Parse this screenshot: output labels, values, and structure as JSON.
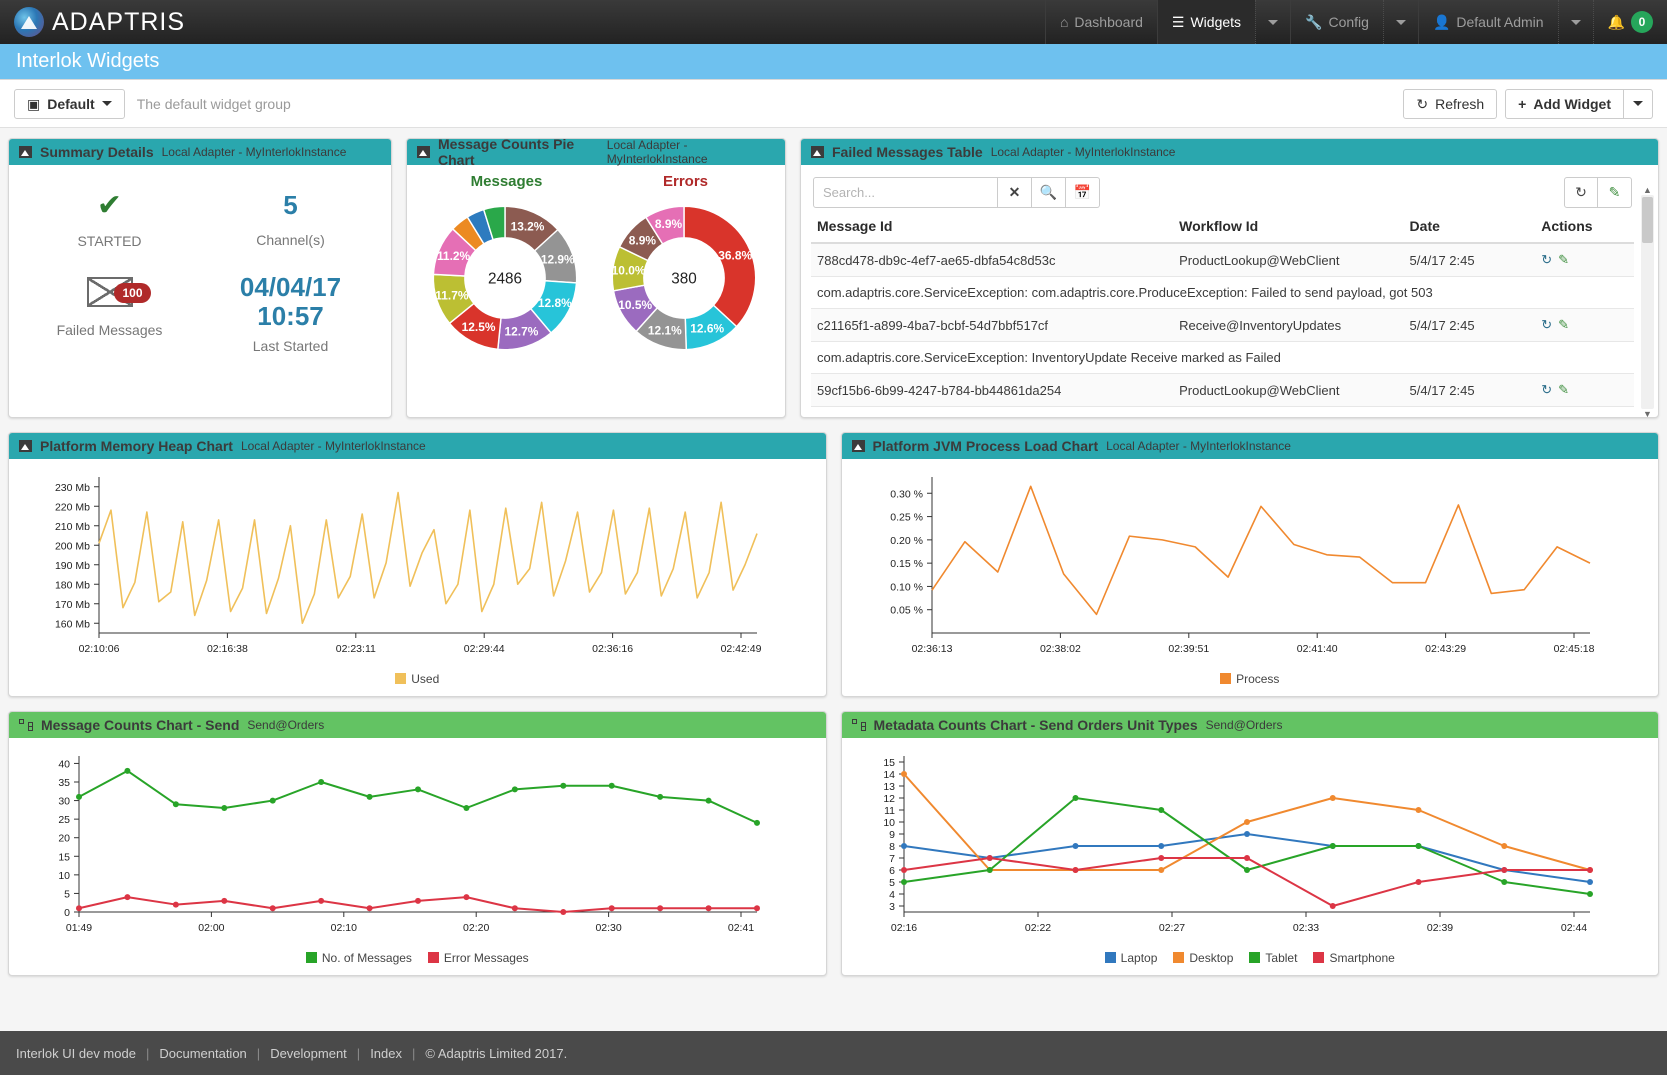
{
  "navbar": {
    "brand": "ADAPTRIS",
    "items": [
      {
        "label": "Dashboard",
        "icon": "home-icon",
        "active": false,
        "caret": false
      },
      {
        "label": "Widgets",
        "icon": "widgets-icon",
        "active": true,
        "caret": true
      },
      {
        "label": "Config",
        "icon": "wrench-icon",
        "active": false,
        "caret": true
      },
      {
        "label": "Default Admin",
        "icon": "user-icon",
        "active": false,
        "caret": true
      }
    ],
    "notification_count": "0",
    "notification_icon": "bell-icon"
  },
  "page": {
    "title": "Interlok Widgets"
  },
  "toolbar": {
    "group_button": "Default",
    "group_icon": "widget-group-icon",
    "description": "The default widget group",
    "refresh_label": "Refresh",
    "refresh_icon": "refresh-icon",
    "add_widget_label": "Add Widget",
    "add_widget_icon": "plus-icon"
  },
  "summary": {
    "title": "Summary Details",
    "subtitle": "Local Adapter - MyInterlokInstance",
    "status_value": "STARTED",
    "status_icon": "check-icon",
    "channels_value": "5",
    "channels_label": "Channel(s)",
    "failed_count": "100",
    "failed_label": "Failed Messages",
    "failed_icon": "envelope-icon",
    "last_started_value": "04/04/17 10:57",
    "last_started_value_line1": "04/04/17",
    "last_started_value_line2": "10:57",
    "last_started_label": "Last Started"
  },
  "pie": {
    "title": "Message Counts Pie Chart",
    "subtitle": "Local Adapter - MyInterlokInstance"
  },
  "table": {
    "title": "Failed Messages Table",
    "subtitle": "Local Adapter - MyInterlokInstance",
    "search_placeholder": "Search...",
    "search_value": "",
    "clear_icon": "x-icon",
    "search_icon": "magnifier-icon",
    "calendar_icon": "calendar-icon",
    "refresh_icon": "refresh-icon",
    "clean_icon": "eraser-icon",
    "columns": [
      "Message Id",
      "Workflow Id",
      "Date",
      "Actions"
    ],
    "rows": [
      {
        "message_id": "788cd478-db9c-4ef7-ae65-dbfa54c8d53c",
        "workflow_id": "ProductLookup@WebClient",
        "date": "5/4/17 2:45",
        "detail": "com.adaptris.core.ServiceException: com.adaptris.core.ProduceException: Failed to send payload, got 503"
      },
      {
        "message_id": "c21165f1-a899-4ba7-bcbf-54d7bbf517cf",
        "workflow_id": "Receive@InventoryUpdates",
        "date": "5/4/17 2:45",
        "detail": "com.adaptris.core.ServiceException: InventoryUpdate Receive marked as Failed"
      },
      {
        "message_id": "59cf15b6-6b99-4247-b784-bb44861da254",
        "workflow_id": "ProductLookup@WebClient",
        "date": "5/4/17 2:45",
        "detail": ""
      }
    ]
  },
  "heap": {
    "title": "Platform Memory Heap Chart",
    "subtitle": "Local Adapter - MyInterlokInstance",
    "legend_label": "Used"
  },
  "jvm": {
    "title": "Platform JVM Process Load Chart",
    "subtitle": "Local Adapter - MyInterlokInstance",
    "legend_label": "Process"
  },
  "msgcounts": {
    "title": "Message Counts Chart - Send",
    "subtitle": "Send@Orders",
    "legend": [
      "No. of Messages",
      "Error Messages"
    ]
  },
  "metadata": {
    "title": "Metadata Counts Chart - Send Orders Unit Types",
    "subtitle": "Send@Orders",
    "legend": [
      "Laptop",
      "Desktop",
      "Tablet",
      "Smartphone"
    ]
  },
  "footer": {
    "app": "Interlok UI  dev mode",
    "links": [
      "Documentation",
      "Development",
      "Index"
    ],
    "copyright": "© Adaptris Limited 2017."
  },
  "colors": {
    "teal": "#2aa7ae",
    "green": "#63c363",
    "page_title_bg": "#6ec1ef",
    "heap_line": "#f0c05a",
    "jvm_line": "#f0892f",
    "series_green": "#28a428",
    "series_red": "#dc3545",
    "series_blue": "#3178be",
    "series_orange": "#f0892f"
  },
  "chart_data": [
    {
      "type": "pie",
      "title": "Messages",
      "title_color": "#2f7d32",
      "center_label": "2486",
      "labels": [
        "13.2%",
        "12.9%",
        "12.8%",
        "12.7%",
        "12.5%",
        "11.7%",
        "11.2%",
        "4.2%",
        "4.0%",
        "4.8%"
      ],
      "values": [
        13.2,
        12.9,
        12.8,
        12.7,
        12.5,
        11.7,
        11.2,
        4.2,
        4.0,
        4.8
      ],
      "colors": [
        "#8c5b51",
        "#949494",
        "#27c4d9",
        "#9b6bbf",
        "#d9342b",
        "#bcbf33",
        "#e56fb5",
        "#ec8a22",
        "#2d7bbf",
        "#2aa84a"
      ],
      "show_labels": [
        true,
        true,
        true,
        true,
        true,
        true,
        true,
        false,
        false,
        false
      ]
    },
    {
      "type": "pie",
      "title": "Errors",
      "title_color": "#b02a2a",
      "center_label": "380",
      "labels": [
        "36.8%",
        "12.6%",
        "12.1%",
        "10.5%",
        "10.0%",
        "8.9%",
        "8.9%"
      ],
      "values": [
        36.8,
        12.6,
        12.1,
        10.5,
        10.0,
        8.9,
        8.9
      ],
      "colors": [
        "#d9342b",
        "#27c4d9",
        "#949494",
        "#9b6bbf",
        "#bcbf33",
        "#8c5b51",
        "#e56fb5"
      ],
      "show_labels": [
        true,
        true,
        true,
        true,
        true,
        true,
        true
      ]
    },
    {
      "type": "line",
      "name": "Platform Memory Heap Chart",
      "ylabel": "",
      "ylim": [
        155,
        235
      ],
      "yticks": [
        "160 Mb",
        "170 Mb",
        "180 Mb",
        "190 Mb",
        "200 Mb",
        "210 Mb",
        "220 Mb",
        "230 Mb"
      ],
      "ytick_values": [
        160,
        170,
        180,
        190,
        200,
        210,
        220,
        230
      ],
      "xticks": [
        "02:10:06",
        "02:16:38",
        "02:23:11",
        "02:29:44",
        "02:36:16",
        "02:42:49"
      ],
      "series": [
        {
          "name": "Used",
          "color": "#f0c05a",
          "values": [
            201,
            218,
            168,
            181,
            217,
            171,
            176,
            212,
            164,
            182,
            213,
            166,
            178,
            213,
            165,
            183,
            210,
            160,
            175,
            213,
            173,
            184,
            216,
            173,
            191,
            227,
            179,
            196,
            208,
            170,
            180,
            218,
            166,
            180,
            219,
            180,
            188,
            222,
            174,
            192,
            217,
            176,
            186,
            218,
            175,
            186,
            219,
            174,
            188,
            217,
            173,
            186,
            222,
            177,
            190,
            206
          ]
        }
      ]
    },
    {
      "type": "line",
      "name": "Platform JVM Process Load Chart",
      "ylabel": "%",
      "ylim": [
        0,
        0.335
      ],
      "yticks": [
        "0.05 %",
        "0.10 %",
        "0.15 %",
        "0.20 %",
        "0.25 %",
        "0.30 %"
      ],
      "ytick_values": [
        0.05,
        0.1,
        0.15,
        0.2,
        0.25,
        0.3
      ],
      "xticks": [
        "02:36:13",
        "02:38:02",
        "02:39:51",
        "02:41:40",
        "02:43:29",
        "02:45:18"
      ],
      "series": [
        {
          "name": "Process",
          "color": "#f0892f",
          "values": [
            0.092,
            0.196,
            0.131,
            0.315,
            0.127,
            0.04,
            0.208,
            0.2,
            0.185,
            0.12,
            0.272,
            0.19,
            0.168,
            0.163,
            0.108,
            0.108,
            0.275,
            0.085,
            0.093,
            0.185,
            0.15
          ]
        }
      ]
    },
    {
      "type": "line",
      "name": "Message Counts Chart - Send",
      "ylim": [
        0,
        42
      ],
      "yticks": [
        "0",
        "5",
        "10",
        "15",
        "20",
        "25",
        "30",
        "35",
        "40"
      ],
      "ytick_values": [
        0,
        5,
        10,
        15,
        20,
        25,
        30,
        35,
        40
      ],
      "xticks": [
        "01:49",
        "02:00",
        "02:10",
        "02:20",
        "02:30",
        "02:41"
      ],
      "x_count": 14,
      "series": [
        {
          "name": "No. of Messages",
          "color": "#28a428",
          "values": [
            31,
            38,
            29,
            28,
            30,
            35,
            31,
            33,
            28,
            33,
            34,
            34,
            31,
            30,
            24
          ]
        },
        {
          "name": "Error Messages",
          "color": "#dc3545",
          "values": [
            1,
            4,
            2,
            3,
            1,
            3,
            1,
            3,
            4,
            1,
            0,
            1,
            1,
            1,
            1
          ]
        }
      ]
    },
    {
      "type": "line",
      "name": "Metadata Counts Chart - Send Orders Unit Types",
      "ylim": [
        2.5,
        15.5
      ],
      "yticks": [
        "3",
        "4",
        "5",
        "6",
        "7",
        "8",
        "9",
        "10",
        "11",
        "12",
        "13",
        "14",
        "15"
      ],
      "ytick_values": [
        3,
        4,
        5,
        6,
        7,
        8,
        9,
        10,
        11,
        12,
        13,
        14,
        15
      ],
      "xticks": [
        "02:16",
        "02:22",
        "02:27",
        "02:33",
        "02:39",
        "02:44"
      ],
      "series": [
        {
          "name": "Laptop",
          "color": "#3178be",
          "values": [
            8,
            7,
            8,
            8,
            9,
            8,
            8,
            6,
            5
          ]
        },
        {
          "name": "Desktop",
          "color": "#f0892f",
          "values": [
            14,
            6,
            6,
            6,
            10,
            12,
            11,
            8,
            6
          ]
        },
        {
          "name": "Tablet",
          "color": "#28a428",
          "values": [
            5,
            6,
            12,
            11,
            6,
            8,
            8,
            5,
            4
          ]
        },
        {
          "name": "Smartphone",
          "color": "#dc3545",
          "values": [
            6,
            7,
            6,
            7,
            7,
            3,
            5,
            6,
            6
          ]
        }
      ]
    }
  ]
}
